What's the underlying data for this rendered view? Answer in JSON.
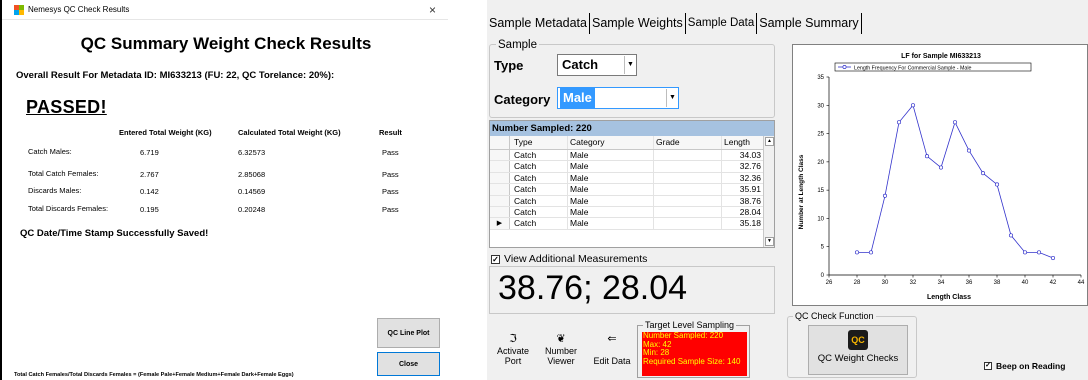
{
  "dialog": {
    "window_title": "Nemesys QC Check Results",
    "heading": "QC Summary Weight Check Results",
    "overall": "Overall Result For Metadata ID: MI633213 (FU: 22, QC Torelance: 20%):",
    "passed": "PASSED!",
    "columns": [
      "Entered Total Weight (KG)",
      "Calculated Total Weight (KG)",
      "Result"
    ],
    "rows": [
      {
        "label": "Catch Males:",
        "entered": "6.719",
        "calculated": "6.32573",
        "result": "Pass"
      },
      {
        "label": "Total Catch Females:",
        "entered": "2.767",
        "calculated": "2.85068",
        "result": "Pass"
      },
      {
        "label": "Discards Males:",
        "entered": "0.142",
        "calculated": "0.14569",
        "result": "Pass"
      },
      {
        "label": "Total Discards Females:",
        "entered": "0.195",
        "calculated": "0.20248",
        "result": "Pass"
      }
    ],
    "saved_message": "QC Date/Time Stamp Successfully Saved!",
    "qc_line_plot_label": "QC Line Plot",
    "close_label": "Close",
    "footer_note": "Total Catch Females/Total Discards Females = (Female Pale+Female Medium+Female Dark+Female Eggs)",
    "close_icon": "×"
  },
  "app": {
    "tabs": [
      "Sample Metadata",
      "Sample Weights",
      "Sample Data",
      "Sample Summary"
    ],
    "active_tab": "Sample Data",
    "sample_group_label": "Sample",
    "type_label": "Type",
    "type_value": "Catch",
    "category_label": "Category",
    "category_value": "Male",
    "grid": {
      "title": "Number Sampled: 220",
      "columns": [
        "Type",
        "Category",
        "Grade",
        "Length"
      ],
      "rows": [
        [
          "Catch",
          "Male",
          "",
          "34.03"
        ],
        [
          "Catch",
          "Male",
          "",
          "32.76"
        ],
        [
          "Catch",
          "Male",
          "",
          "32.36"
        ],
        [
          "Catch",
          "Male",
          "",
          "35.91"
        ],
        [
          "Catch",
          "Male",
          "",
          "38.76"
        ],
        [
          "Catch",
          "Male",
          "",
          "28.04"
        ],
        [
          "Catch",
          "Male",
          "",
          "35.18"
        ]
      ]
    },
    "view_additional_label": "View Additional Measurements",
    "measurement_display": "38.76; 28.04",
    "tools": [
      {
        "label_1": "Activate",
        "label_2": "Port",
        "icon": "port-icon"
      },
      {
        "label_1": "Number",
        "label_2": "Viewer",
        "icon": "viewer-icon"
      },
      {
        "label_1": "",
        "label_2": "Edit Data",
        "icon": "edit-icon"
      }
    ],
    "target": {
      "legend": "Target Level Sampling",
      "lines": [
        "Number Sampled: 220",
        "Max: 42",
        "Min: 28",
        "Required Sample Size: 140"
      ]
    },
    "qc_function_legend": "QC Check Function",
    "qc_weight_checks_label": "QC Weight Checks",
    "qc_logo_text": "QC",
    "beep_label": "Beep on Reading",
    "colors": {
      "accent": "#3399ff",
      "grid_header": "#a6c2e0",
      "target_bg": "#ff0000",
      "target_text": "#ffff00",
      "series": "#3333cc"
    }
  },
  "chart_data": {
    "type": "line",
    "title": "LF for Sample MI633213",
    "xlabel": "Length Class",
    "ylabel": "Number at Length Class",
    "legend": "Length Frequency For Commercial Sample - Male",
    "legend_position": "top",
    "xlim": [
      26,
      44
    ],
    "ylim": [
      0,
      35
    ],
    "xticks": [
      26,
      28,
      30,
      32,
      34,
      36,
      38,
      40,
      42,
      44
    ],
    "yticks": [
      0,
      5,
      10,
      15,
      20,
      25,
      30,
      35
    ],
    "grid": false,
    "series": [
      {
        "name": "Length Frequency For Commercial Sample - Male",
        "x": [
          28,
          29,
          30,
          31,
          32,
          33,
          34,
          35,
          36,
          37,
          38,
          39,
          40,
          41,
          42
        ],
        "y": [
          4,
          4,
          14,
          27,
          30,
          21,
          19,
          27,
          22,
          18,
          16,
          7,
          4,
          4,
          3
        ]
      }
    ]
  }
}
